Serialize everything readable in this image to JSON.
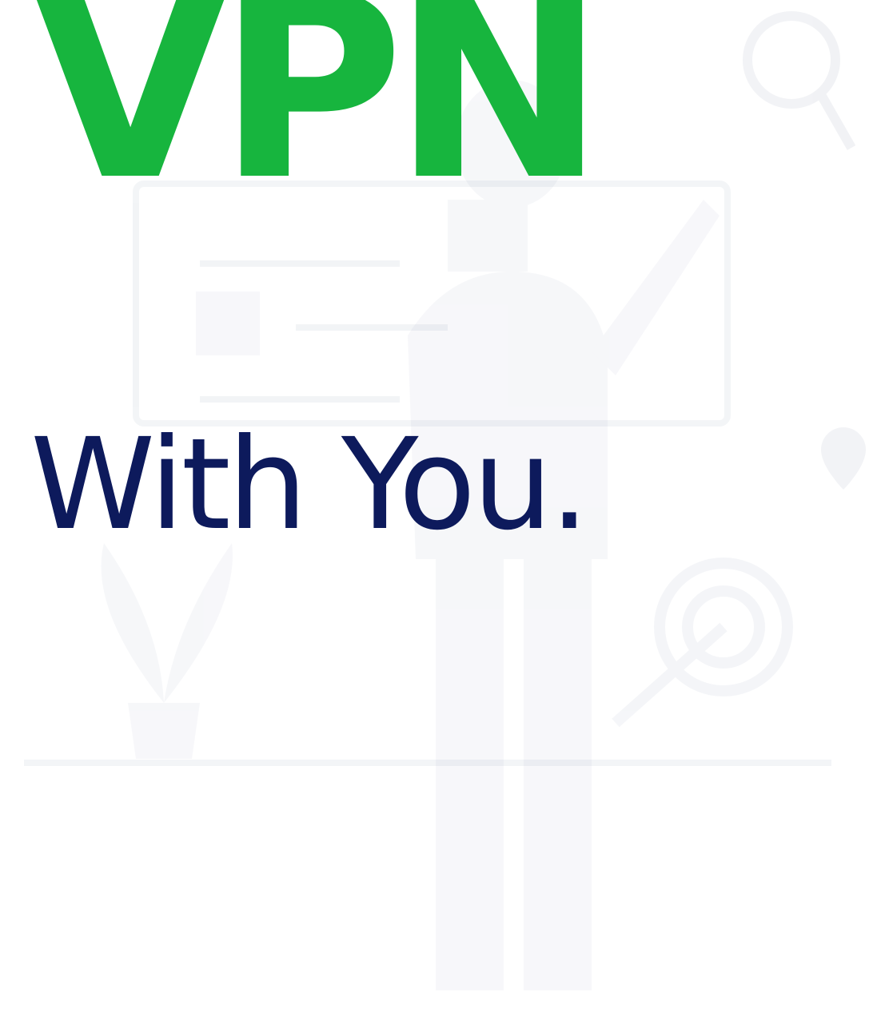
{
  "logo": {
    "prefix": "-",
    "brand": "VPN"
  },
  "tagline": "With You.",
  "colors": {
    "brand_green": "#17b53e",
    "tagline_navy": "#0d1a5c",
    "background": "#ffffff"
  },
  "background_icons": [
    "search-icon",
    "location-pin-icon",
    "target-icon",
    "plant-pot-icon"
  ]
}
